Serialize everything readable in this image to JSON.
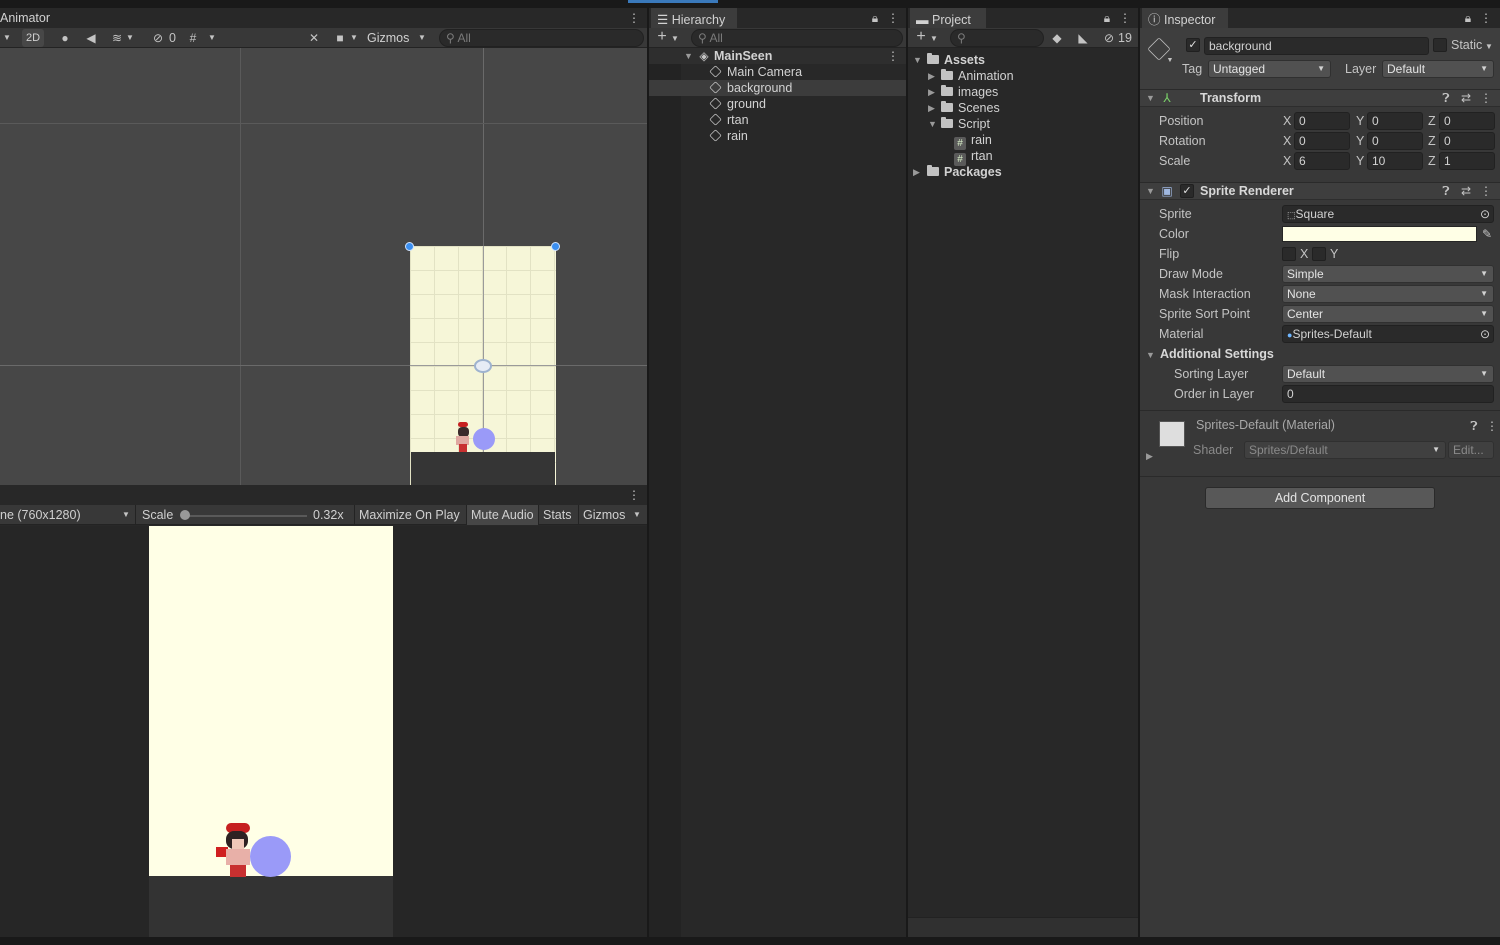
{
  "top_bar": {
    "visible": true
  },
  "scene": {
    "tab_label": "Animator",
    "mode_2d": "2D",
    "hidden_count": "0",
    "gizmos_label": "Gizmos",
    "search_placeholder": "All"
  },
  "game": {
    "resolution": "ne (760x1280)",
    "scale_label": "Scale",
    "scale_value": "0.32x",
    "maximize_on_play": "Maximize On Play",
    "mute_audio": "Mute Audio",
    "stats": "Stats",
    "gizmos": "Gizmos",
    "background_color": "#ffffe6"
  },
  "hierarchy": {
    "tab_label": "Hierarchy",
    "search_placeholder": "All",
    "scene_name": "MainSeen",
    "items": [
      "Main Camera",
      "background",
      "ground",
      "rtan",
      "rain"
    ],
    "selected": "background"
  },
  "project": {
    "tab_label": "Project",
    "hidden_count": "19",
    "root": "Assets",
    "folders": [
      "Animation",
      "images",
      "Scenes"
    ],
    "script_folder": "Script",
    "scripts": [
      "rain",
      "rtan"
    ],
    "packages": "Packages"
  },
  "inspector": {
    "tab_label": "Inspector",
    "object_name": "background",
    "static_label": "Static",
    "tag_label": "Tag",
    "tag_value": "Untagged",
    "layer_label": "Layer",
    "layer_value": "Default",
    "transform": {
      "title": "Transform",
      "position_label": "Position",
      "rotation_label": "Rotation",
      "scale_label": "Scale",
      "position": {
        "x": "0",
        "y": "0",
        "z": "0"
      },
      "rotation": {
        "x": "0",
        "y": "0",
        "z": "0"
      },
      "scale": {
        "x": "6",
        "y": "10",
        "z": "1"
      }
    },
    "sprite_renderer": {
      "title": "Sprite Renderer",
      "sprite_label": "Sprite",
      "sprite_value": "Square",
      "color_label": "Color",
      "color_value": "#ffffe6",
      "flip_label": "Flip",
      "flip_x": "X",
      "flip_y": "Y",
      "draw_mode_label": "Draw Mode",
      "draw_mode_value": "Simple",
      "mask_label": "Mask Interaction",
      "mask_value": "None",
      "sort_point_label": "Sprite Sort Point",
      "sort_point_value": "Center",
      "material_label": "Material",
      "material_value": "Sprites-Default",
      "additional_settings": "Additional Settings",
      "sorting_layer_label": "Sorting Layer",
      "sorting_layer_value": "Default",
      "order_label": "Order in Layer",
      "order_value": "0"
    },
    "material": {
      "title": "Sprites-Default (Material)",
      "shader_label": "Shader",
      "shader_value": "Sprites/Default",
      "edit_label": "Edit..."
    },
    "add_component": "Add Component"
  }
}
